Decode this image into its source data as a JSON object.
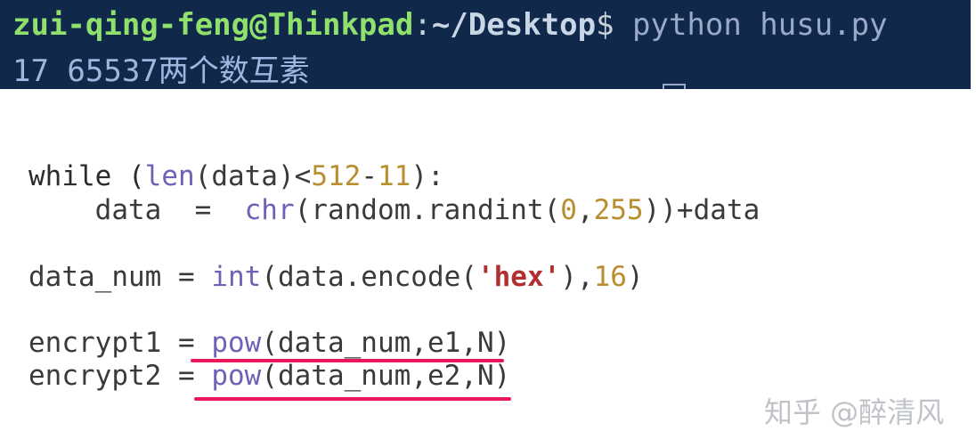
{
  "terminal": {
    "user_host": "zui-qing-feng@Thinkpad",
    "colon": ":",
    "path": "~/Desktop",
    "dollar": "$",
    "command": " python husu.py",
    "output": "17 65537两个数互素"
  },
  "code": {
    "line1": {
      "a": "while (",
      "b": "len",
      "c": "(data)<",
      "d": "512",
      "e": "-",
      "f": "11",
      "g": "):"
    },
    "line2": {
      "a": "    data  =  ",
      "b": "chr",
      "c": "(random.randint(",
      "d": "0",
      "e": ",",
      "f": "255",
      "g": "))+data"
    },
    "line3": {
      "a": "data_num = ",
      "b": "int",
      "c": "(data.encode(",
      "d": "'hex'",
      "e": "),",
      "f": "16",
      "g": ")"
    },
    "line4": {
      "a": "encrypt1 = ",
      "b": "pow",
      "c": "(data_num,e1,N)"
    },
    "line5": {
      "a": "encrypt2 = ",
      "b": "pow",
      "c": "(data_num,e2,N)"
    }
  },
  "watermark": "知乎 @醉清风",
  "colors": {
    "terminal_bg": "#10294a",
    "prompt_user": "#8fe06c",
    "underline": "#e8195a",
    "function": "#6c63b8",
    "number": "#b78f2e",
    "string": "#b0302f"
  }
}
